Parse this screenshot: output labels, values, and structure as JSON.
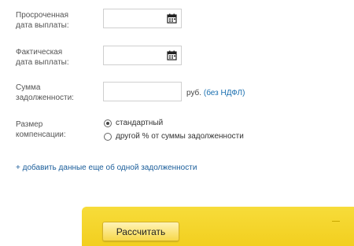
{
  "form": {
    "overdue_date": {
      "label_line1": "Просроченная",
      "label_line2": "дата выплаты:",
      "value": ""
    },
    "actual_date": {
      "label_line1": "Фактическая",
      "label_line2": "дата выплаты:",
      "value": ""
    },
    "debt_sum": {
      "label_line1": "Сумма",
      "label_line2": "задолженности:",
      "value": "",
      "suffix_currency": "руб.",
      "suffix_note": "(без НДФЛ)"
    },
    "compensation": {
      "label_line1": "Размер",
      "label_line2": "компенсации:",
      "options": [
        {
          "label": "стандартный",
          "selected": true
        },
        {
          "label": "другой % от суммы задолженности",
          "selected": false
        }
      ]
    },
    "add_debt_link": "+ добавить данные еще об одной задолженности"
  },
  "actions": {
    "calculate_label": "Рассчитать"
  },
  "colors": {
    "panel": "#f2cf1f",
    "link": "#1a5d9a"
  },
  "icons": {
    "date_picker": "calendar-icon"
  }
}
